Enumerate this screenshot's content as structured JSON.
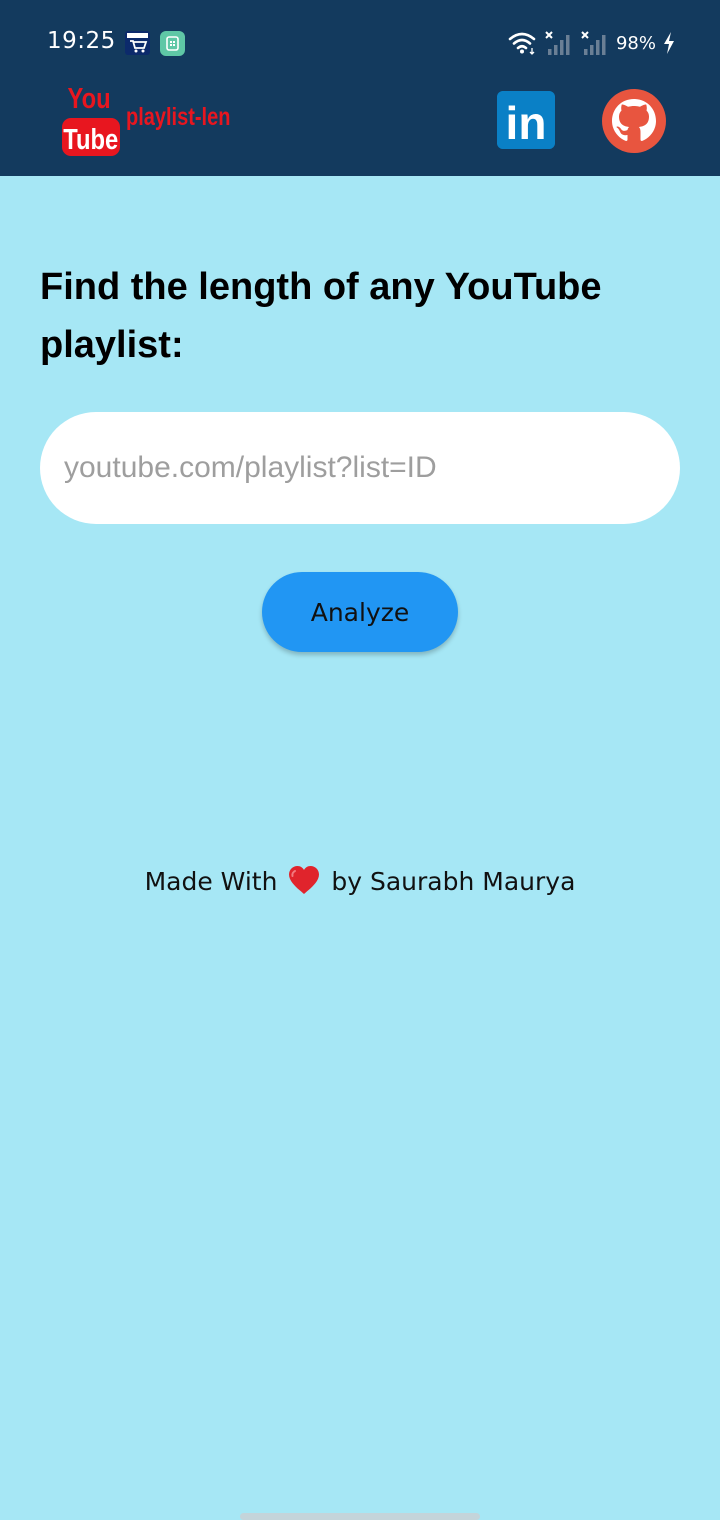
{
  "status_bar": {
    "time": "19:25",
    "battery": "98%",
    "notification_icons": [
      "amazon-shopping-icon",
      "app-notification-icon"
    ],
    "system_icons": [
      "wifi-icon",
      "signal-icon",
      "signal-icon",
      "battery-charging-icon"
    ]
  },
  "app_bar": {
    "logo_text": {
      "line1": "You",
      "line2": "Tube",
      "line3": "playlist-len"
    },
    "actions": [
      {
        "icon": "linkedin-icon",
        "label": "in"
      },
      {
        "icon": "github-icon"
      }
    ]
  },
  "main": {
    "headline": "Find the length of any YouTube playlist:",
    "input_placeholder": "youtube.com/playlist?list=ID",
    "input_value": "",
    "analyze_label": "Analyze"
  },
  "footer": {
    "made_with": "Made With",
    "by_text": "by Saurabh Maurya"
  },
  "colors": {
    "app_bar": "#133a5e",
    "background": "#a6e7f5",
    "button": "#2196f3",
    "logo_red": "#e8161f",
    "linkedin_blue": "#0a80c6",
    "github_orange": "#e8553f"
  }
}
